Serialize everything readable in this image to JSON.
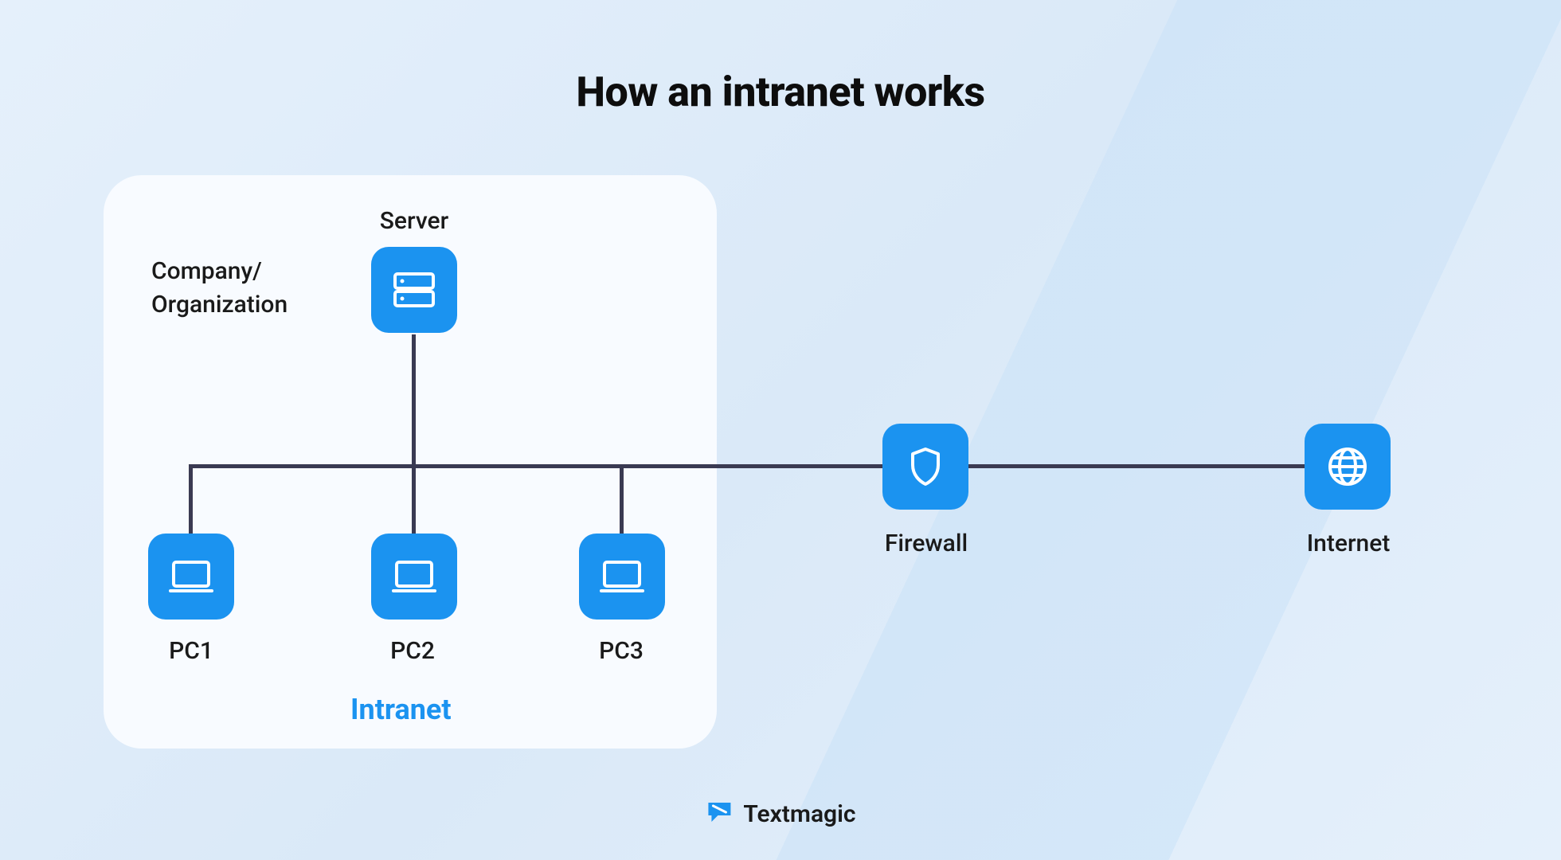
{
  "title": "How an intranet works",
  "companyLabel": "Company/\nOrganization",
  "intranetLabel": "Intranet",
  "nodes": {
    "server": "Server",
    "pc1": "PC1",
    "pc2": "PC2",
    "pc3": "PC3",
    "firewall": "Firewall",
    "internet": "Internet"
  },
  "brand": "Textmagic",
  "colors": {
    "accent": "#1b93f0",
    "line": "#3a3a52"
  }
}
